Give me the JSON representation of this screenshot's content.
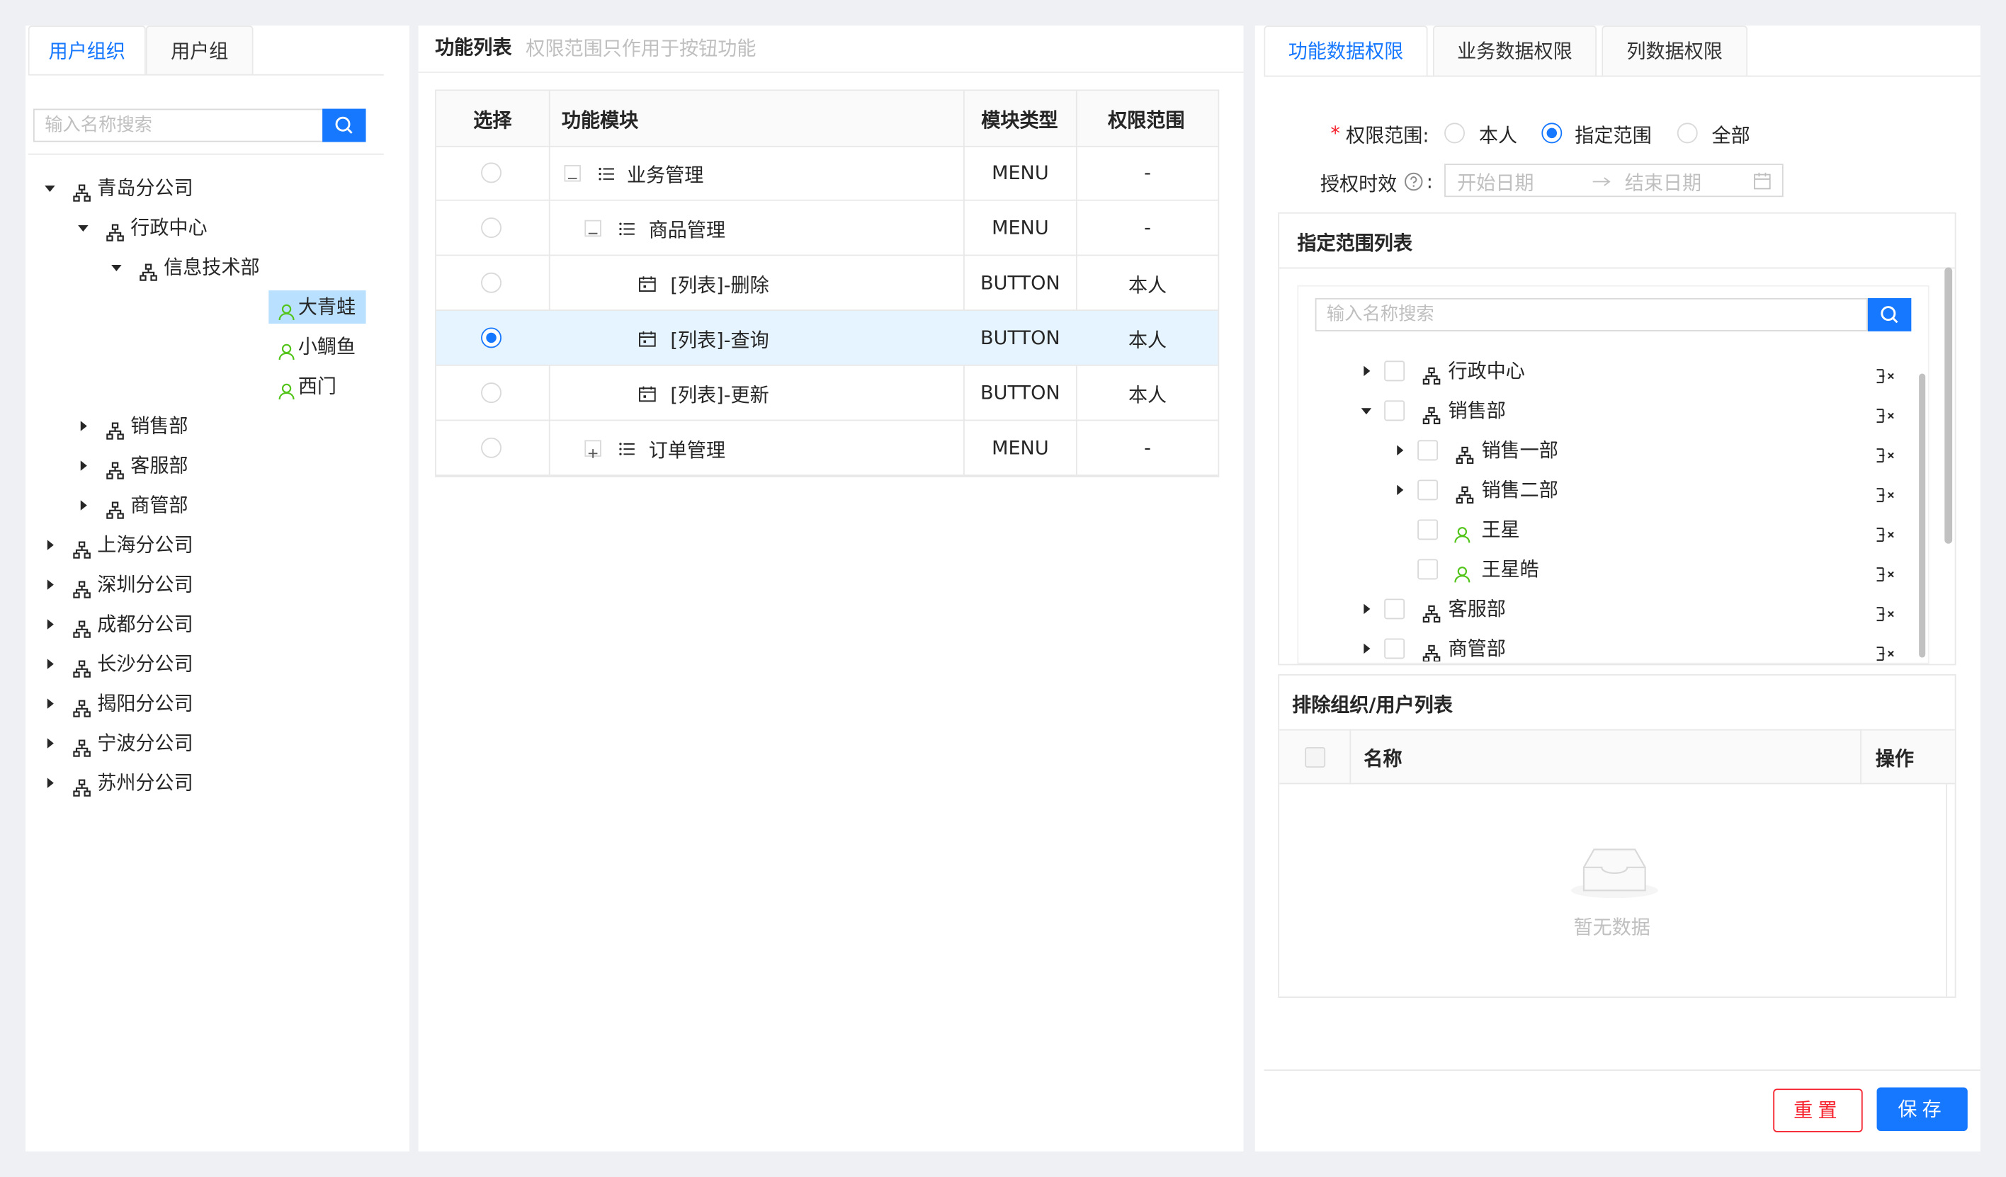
{
  "left": {
    "tabs": [
      "用户组织",
      "用户组"
    ],
    "search_placeholder": "输入名称搜索",
    "tree": [
      {
        "label": "青岛分公司"
      },
      {
        "label": "行政中心"
      },
      {
        "label": "信息技术部"
      },
      {
        "label": "大青蛙"
      },
      {
        "label": "小鲷鱼"
      },
      {
        "label": "西门"
      },
      {
        "label": "销售部"
      },
      {
        "label": "客服部"
      },
      {
        "label": "商管部"
      },
      {
        "label": "上海分公司"
      },
      {
        "label": "深圳分公司"
      },
      {
        "label": "成都分公司"
      },
      {
        "label": "长沙分公司"
      },
      {
        "label": "揭阳分公司"
      },
      {
        "label": "宁波分公司"
      },
      {
        "label": "苏州分公司"
      }
    ]
  },
  "middle": {
    "title": "功能列表",
    "hint": "权限范围只作用于按钮功能",
    "headers": [
      "选择",
      "功能模块",
      "模块类型",
      "权限范围"
    ],
    "rows": [
      {
        "name": "业务管理",
        "type": "MENU",
        "scope": "-"
      },
      {
        "name": "商品管理",
        "type": "MENU",
        "scope": "-"
      },
      {
        "name": "[列表]-删除",
        "type": "BUTTON",
        "scope": "本人"
      },
      {
        "name": "[列表]-查询",
        "type": "BUTTON",
        "scope": "本人"
      },
      {
        "name": "[列表]-更新",
        "type": "BUTTON",
        "scope": "本人"
      },
      {
        "name": "订单管理",
        "type": "MENU",
        "scope": "-"
      }
    ]
  },
  "right": {
    "tabs": [
      "功能数据权限",
      "业务数据权限",
      "列数据权限"
    ],
    "scope_label": "权限范围:",
    "scope_options": [
      "本人",
      "指定范围",
      "全部"
    ],
    "scope_selected": "指定范围",
    "validity_label": "授权时效",
    "start_placeholder": "开始日期",
    "end_placeholder": "结束日期",
    "range_list_title": "指定范围列表",
    "range_search_placeholder": "输入名称搜索",
    "range_tree": [
      "行政中心",
      "销售部",
      "销售一部",
      "销售二部",
      "王星",
      "王星皓",
      "客服部",
      "商管部"
    ],
    "exclude_title": "排除组织/用户列表",
    "exclude_headers": [
      "名称",
      "操作"
    ],
    "empty_text": "暂无数据",
    "reset_label": "重置",
    "save_label": "保存"
  },
  "colors": {
    "accent": "#1677ff",
    "danger": "#f5222d",
    "user": "#52c41a",
    "selected_row": "#e6f4ff"
  }
}
